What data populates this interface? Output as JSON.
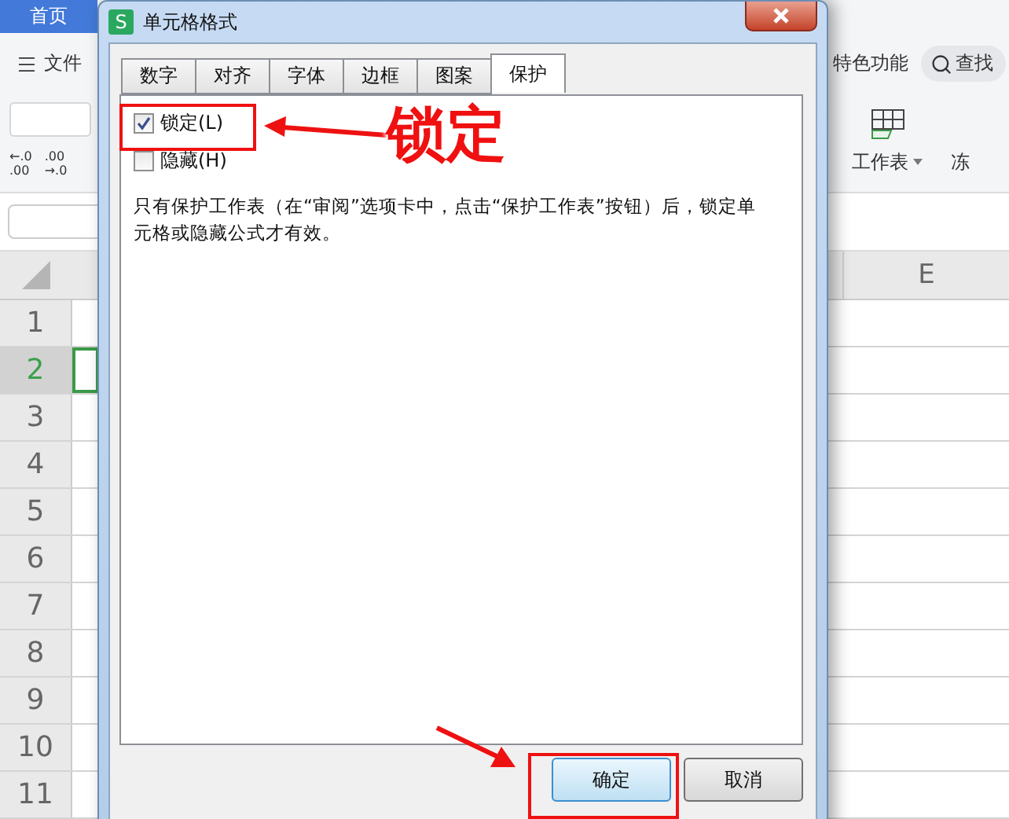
{
  "app": {
    "home_tab": "首页",
    "menu": "文件",
    "feature_label": "特色功能",
    "search": "查找",
    "decimal_buttons": [
      {
        "top": "←.0",
        "bottom": ".00"
      },
      {
        "top": ".00",
        "bottom": "→.0"
      }
    ],
    "ribbon_items": [
      {
        "label": "工作表",
        "kind": "sheet"
      },
      {
        "label": "冻",
        "kind": "partial"
      }
    ],
    "column_header": "E",
    "rows": [
      {
        "label": "1",
        "selected": false
      },
      {
        "label": "2",
        "selected": true
      },
      {
        "label": "3",
        "selected": false
      },
      {
        "label": "4",
        "selected": false
      },
      {
        "label": "5",
        "selected": false
      },
      {
        "label": "6",
        "selected": false
      },
      {
        "label": "7",
        "selected": false
      },
      {
        "label": "8",
        "selected": false
      },
      {
        "label": "9",
        "selected": false
      },
      {
        "label": "10",
        "selected": false
      },
      {
        "label": "11",
        "selected": false
      }
    ]
  },
  "dialog": {
    "badge": "S",
    "title": "单元格格式",
    "tabs": [
      {
        "label": "数字",
        "selected": false
      },
      {
        "label": "对齐",
        "selected": false
      },
      {
        "label": "字体",
        "selected": false
      },
      {
        "label": "边框",
        "selected": false
      },
      {
        "label": "图案",
        "selected": false
      },
      {
        "label": "保护",
        "selected": true
      }
    ],
    "options": [
      {
        "label": "锁定(L)",
        "checked": true
      },
      {
        "label": "隐藏(H)",
        "checked": false
      }
    ],
    "note": "只有保护工作表（在“审阅”选项卡中，点击“保护工作表”按钮）后，锁定单元格或隐藏公式才有效。",
    "buttons": [
      {
        "label": "确定",
        "kind": "primary"
      },
      {
        "label": "取消",
        "kind": "normal"
      }
    ]
  },
  "annotation": {
    "callout": "锁定"
  }
}
